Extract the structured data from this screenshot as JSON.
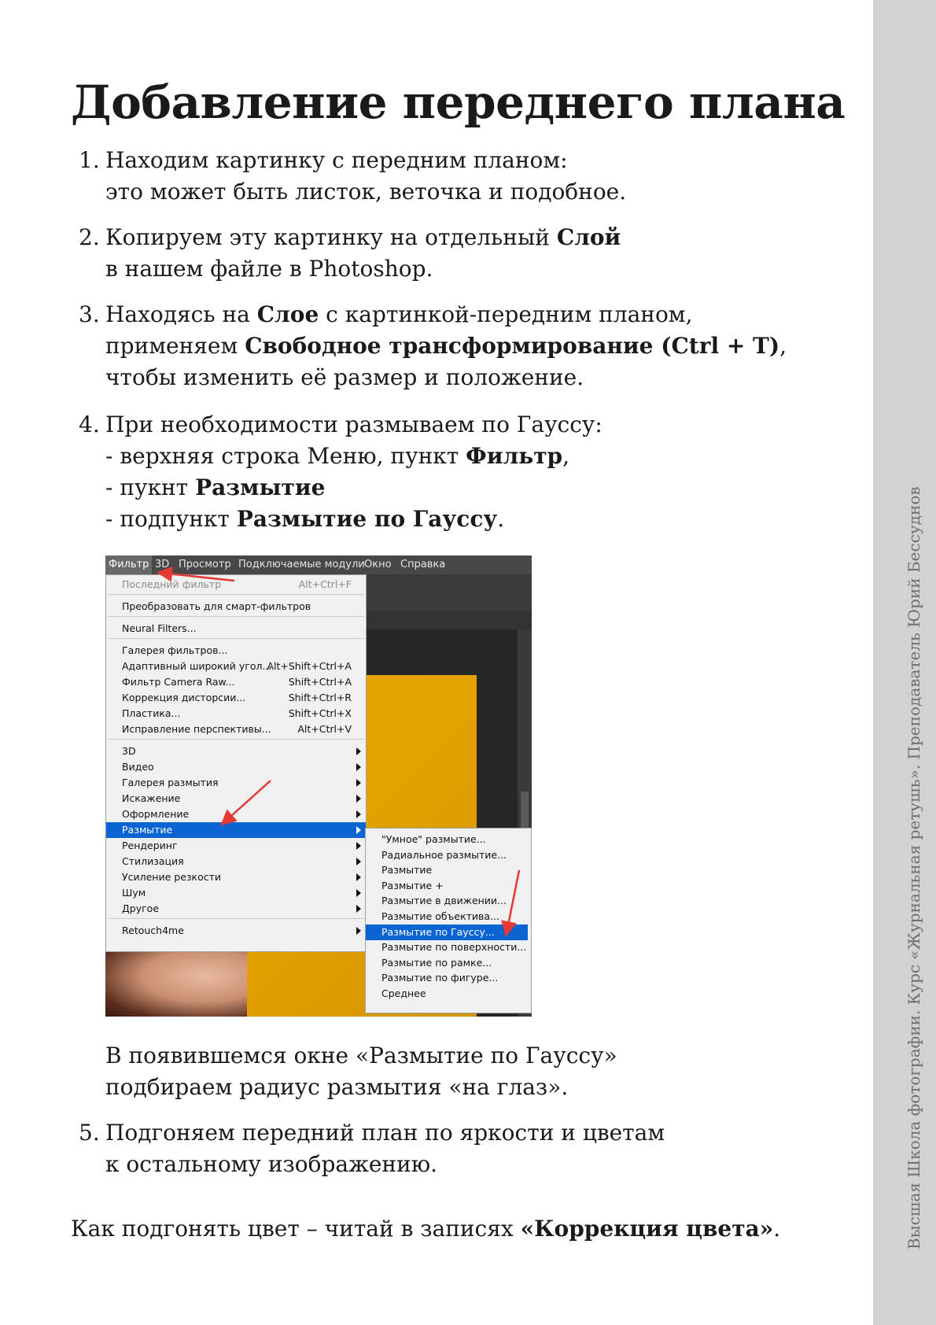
{
  "sidebar_text": "Высшая Школа фотографии. Курс «Журнальная ретушь». Преподаватель Юрий Бессуднов",
  "title": "Добавление переднего плана",
  "steps": [
    {
      "num": "1.",
      "lines": [
        [
          "Находим картинку с передним планом:"
        ],
        [
          "это может быть листок, веточка и подобное."
        ]
      ]
    },
    {
      "num": "2.",
      "line1": "Копируем эту картинку на отдельный ",
      "line1_bold": "Слой",
      "line2": "в нашем файле в Photoshop."
    },
    {
      "num": "3.",
      "line1a": "Находясь на ",
      "line1_bold": "Слое",
      "line1b": " с картинкой-передним планом,",
      "line2a": "применяем ",
      "line2_bold": "Свободное трансформирование (Ctrl + T)",
      "line2b": ",",
      "line3": "чтобы изменить её размер и положение."
    },
    {
      "num": "4.",
      "line1": "При необходимости размываем по Гауссу:",
      "line2a": "- верхняя строка Меню, пункт ",
      "line2_bold": "Фильтр",
      "line2b": ",",
      "line3a": "- пукнт ",
      "line3_bold": "Размытие",
      "line4a": "- подпункт ",
      "line4_bold": "Размытие по Гауссу",
      "line4b": "."
    },
    {
      "num": "5.",
      "line1": "Подгоняем передний план по яркости и цветам",
      "line2": "к остальному изображению."
    }
  ],
  "after_screenshot": {
    "line1": "В появившемся окне «Размытие по Гауссу»",
    "line2": "подбираем радиус размытия «на глаз»."
  },
  "footer": {
    "text": "Как подгонять цвет – читай в записях ",
    "bold": "«Коррекция цвета»",
    "end": "."
  },
  "screenshot": {
    "menubar": [
      "Фильтр",
      "3D",
      "Просмотр",
      "Подключаемые модули",
      "Окно",
      "Справка"
    ],
    "menu_items": [
      {
        "label": "Последний фильтр",
        "shortcut": "Alt+Ctrl+F",
        "disabled": true
      },
      {
        "label": "Преобразовать для смарт-фильтров",
        "shortcut": ""
      },
      {
        "label": "Neural Filters...",
        "shortcut": ""
      },
      {
        "label": "Галерея фильтров...",
        "shortcut": ""
      },
      {
        "label": "Адаптивный широкий угол...",
        "shortcut": "Alt+Shift+Ctrl+A"
      },
      {
        "label": "Фильтр Camera Raw...",
        "shortcut": "Shift+Ctrl+A"
      },
      {
        "label": "Коррекция дисторсии...",
        "shortcut": "Shift+Ctrl+R"
      },
      {
        "label": "Пластика...",
        "shortcut": "Shift+Ctrl+X"
      },
      {
        "label": "Исправление перспективы...",
        "shortcut": "Alt+Ctrl+V"
      },
      {
        "label": "3D",
        "submenu": true
      },
      {
        "label": "Видео",
        "submenu": true
      },
      {
        "label": "Галерея размытия",
        "submenu": true
      },
      {
        "label": "Искажение",
        "submenu": true
      },
      {
        "label": "Оформление",
        "submenu": true
      },
      {
        "label": "Размытие",
        "submenu": true,
        "highlighted": true
      },
      {
        "label": "Рендеринг",
        "submenu": true
      },
      {
        "label": "Стилизация",
        "submenu": true
      },
      {
        "label": "Усиление резкости",
        "submenu": true
      },
      {
        "label": "Шум",
        "submenu": true
      },
      {
        "label": "Другое",
        "submenu": true
      },
      {
        "label": "Retouch4me",
        "submenu": true
      }
    ],
    "submenu_items": [
      {
        "label": "\"Умное\" размытие..."
      },
      {
        "label": "Радиальное размытие..."
      },
      {
        "label": "Размытие"
      },
      {
        "label": "Размытие +"
      },
      {
        "label": "Размытие в движении..."
      },
      {
        "label": "Размытие объектива..."
      },
      {
        "label": "Размытие по Гауссу...",
        "highlighted": true
      },
      {
        "label": "Размытие по поверхности..."
      },
      {
        "label": "Размытие по рамке..."
      },
      {
        "label": "Размытие по фигуре..."
      },
      {
        "label": "Среднее"
      }
    ],
    "colors": {
      "highlight": "#0a64d2",
      "arrow": "#e53935",
      "photo": "#e2a100"
    }
  }
}
